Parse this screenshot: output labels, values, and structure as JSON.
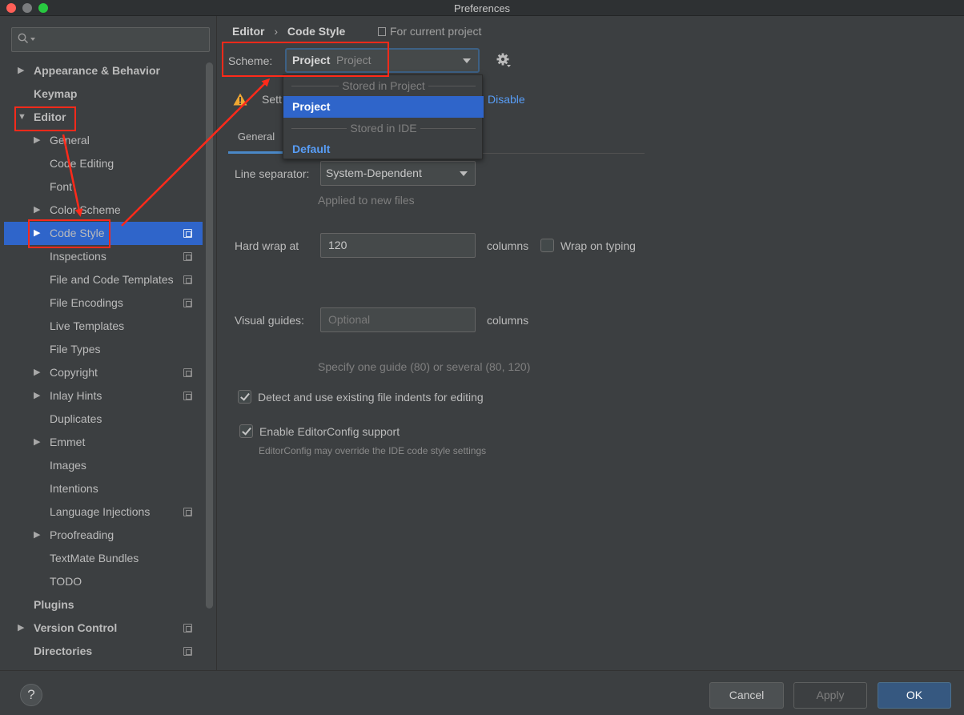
{
  "window": {
    "title": "Preferences"
  },
  "sidebar": {
    "search_placeholder": "",
    "items": [
      {
        "label": "Appearance & Behavior",
        "expandable": true
      },
      {
        "label": "Keymap",
        "expandable": false
      },
      {
        "label": "Editor",
        "expandable": true,
        "expanded": true
      },
      {
        "label": "General",
        "expandable": true
      },
      {
        "label": "Code Editing",
        "expandable": false
      },
      {
        "label": "Font",
        "expandable": false
      },
      {
        "label": "Color Scheme",
        "expandable": true
      },
      {
        "label": "Code Style",
        "expandable": true,
        "selected": true,
        "project_icon": true
      },
      {
        "label": "Inspections",
        "project_icon": true
      },
      {
        "label": "File and Code Templates",
        "project_icon": true
      },
      {
        "label": "File Encodings",
        "project_icon": true
      },
      {
        "label": "Live Templates"
      },
      {
        "label": "File Types"
      },
      {
        "label": "Copyright",
        "expandable": true,
        "project_icon": true
      },
      {
        "label": "Inlay Hints",
        "expandable": true,
        "project_icon": true
      },
      {
        "label": "Duplicates"
      },
      {
        "label": "Emmet",
        "expandable": true
      },
      {
        "label": "Images"
      },
      {
        "label": "Intentions"
      },
      {
        "label": "Language Injections",
        "project_icon": true
      },
      {
        "label": "Proofreading",
        "expandable": true
      },
      {
        "label": "TextMate Bundles"
      },
      {
        "label": "TODO"
      },
      {
        "label": "Plugins"
      },
      {
        "label": "Version Control",
        "expandable": true,
        "project_icon": true
      },
      {
        "label": "Directories",
        "project_icon": true
      }
    ]
  },
  "main": {
    "breadcrumb": {
      "part1": "Editor",
      "separator": "›",
      "part2": "Code Style"
    },
    "for_current_project": "For current project",
    "scheme": {
      "label": "Scheme:",
      "value_bold": "Project",
      "value_gray": "Project"
    },
    "warning": {
      "text": "Sett",
      "link": "Disable"
    },
    "tabs": [
      {
        "label": "General",
        "active": true
      }
    ],
    "line_separator": {
      "label": "Line separator:",
      "value": "System-Dependent",
      "hint": "Applied to new files"
    },
    "hard_wrap": {
      "label": "Hard wrap at",
      "value": "120",
      "unit": "columns",
      "wrap_on_typing_label": "Wrap on typing",
      "wrap_on_typing_checked": false
    },
    "visual_guides": {
      "label": "Visual guides:",
      "placeholder": "Optional",
      "unit": "columns",
      "hint": "Specify one guide (80) or several (80, 120)"
    },
    "detect_indents": {
      "label": "Detect and use existing file indents for editing",
      "checked": true
    },
    "editorconfig": {
      "label": "Enable EditorConfig support",
      "checked": true,
      "hint": "EditorConfig may override the IDE code style settings"
    }
  },
  "scheme_popup": {
    "group1": "Stored in Project",
    "item1": "Project",
    "group2": "Stored in IDE",
    "item2": "Default"
  },
  "footer": {
    "help": "?",
    "cancel": "Cancel",
    "apply": "Apply",
    "ok": "OK"
  },
  "colors": {
    "accent": "#2f65ca",
    "link": "#589df6",
    "annotation": "#ff2a1a",
    "background": "#3c3f41"
  }
}
